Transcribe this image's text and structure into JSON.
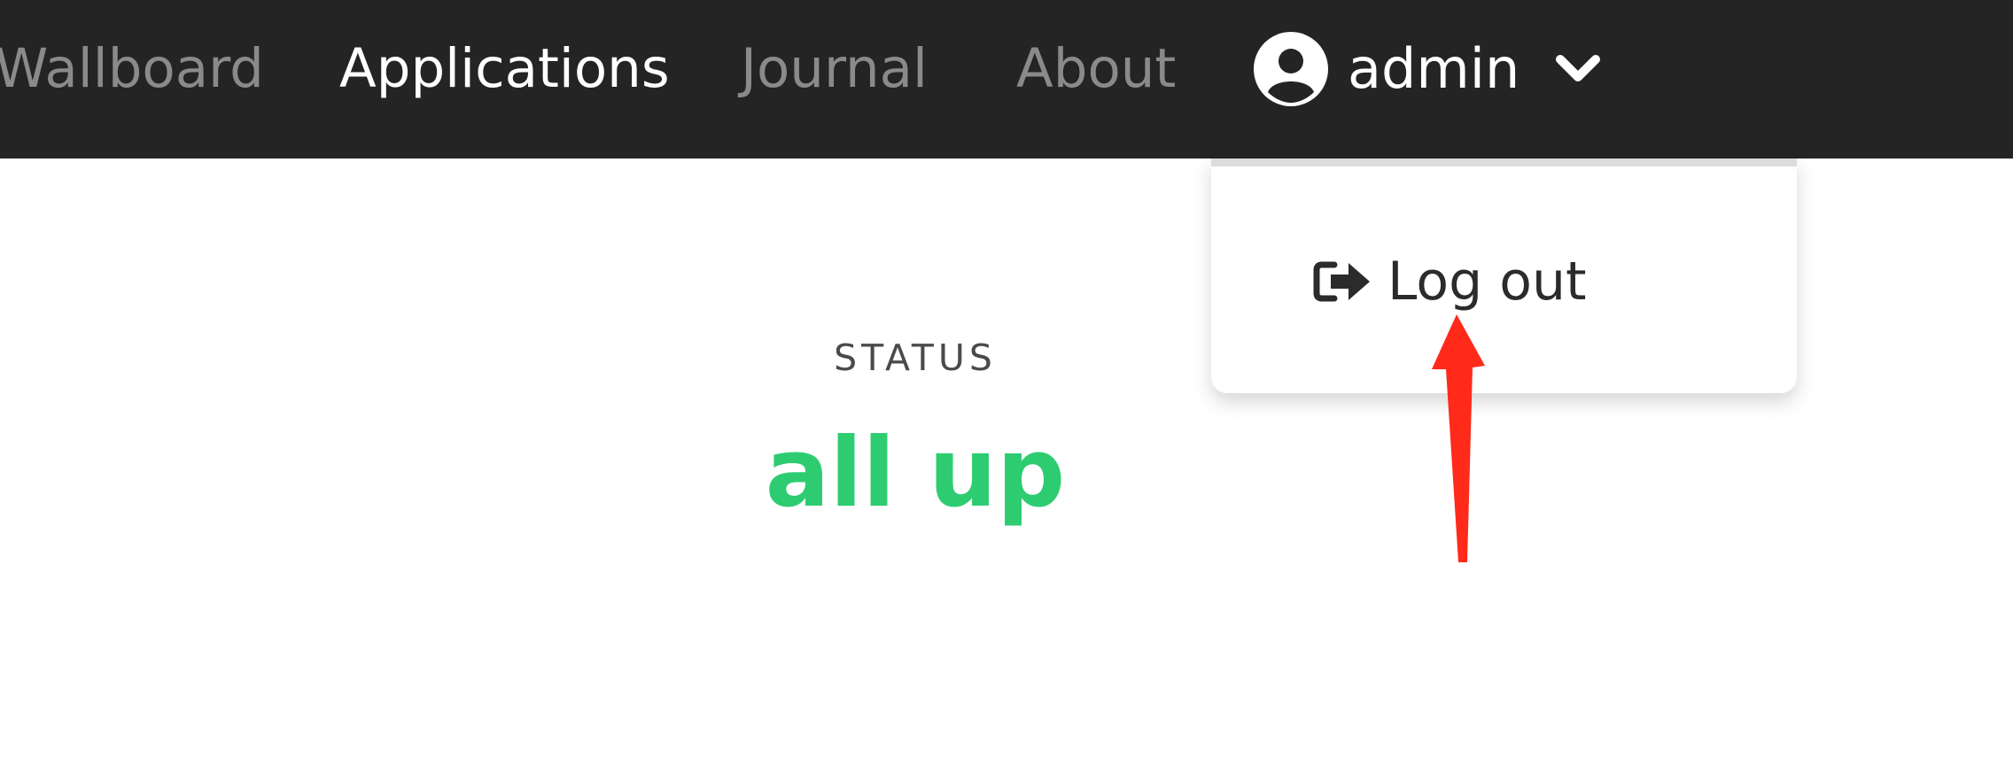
{
  "navbar": {
    "items": [
      {
        "label": "Wallboard",
        "active": false
      },
      {
        "label": "Applications",
        "active": true
      },
      {
        "label": "Journal",
        "active": false
      },
      {
        "label": "About",
        "active": false
      }
    ],
    "user": {
      "name": "admin",
      "icon": "user-circle-icon",
      "toggle_icon": "chevron-down-icon"
    }
  },
  "dropdown": {
    "items": [
      {
        "label": "Log out",
        "icon": "sign-out-icon"
      }
    ]
  },
  "main": {
    "status_label": "STATUS",
    "status_value": "all up"
  },
  "colors": {
    "navbar_bg": "#242424",
    "status_up": "#2ecc71",
    "annotation": "#ff2a1a"
  }
}
